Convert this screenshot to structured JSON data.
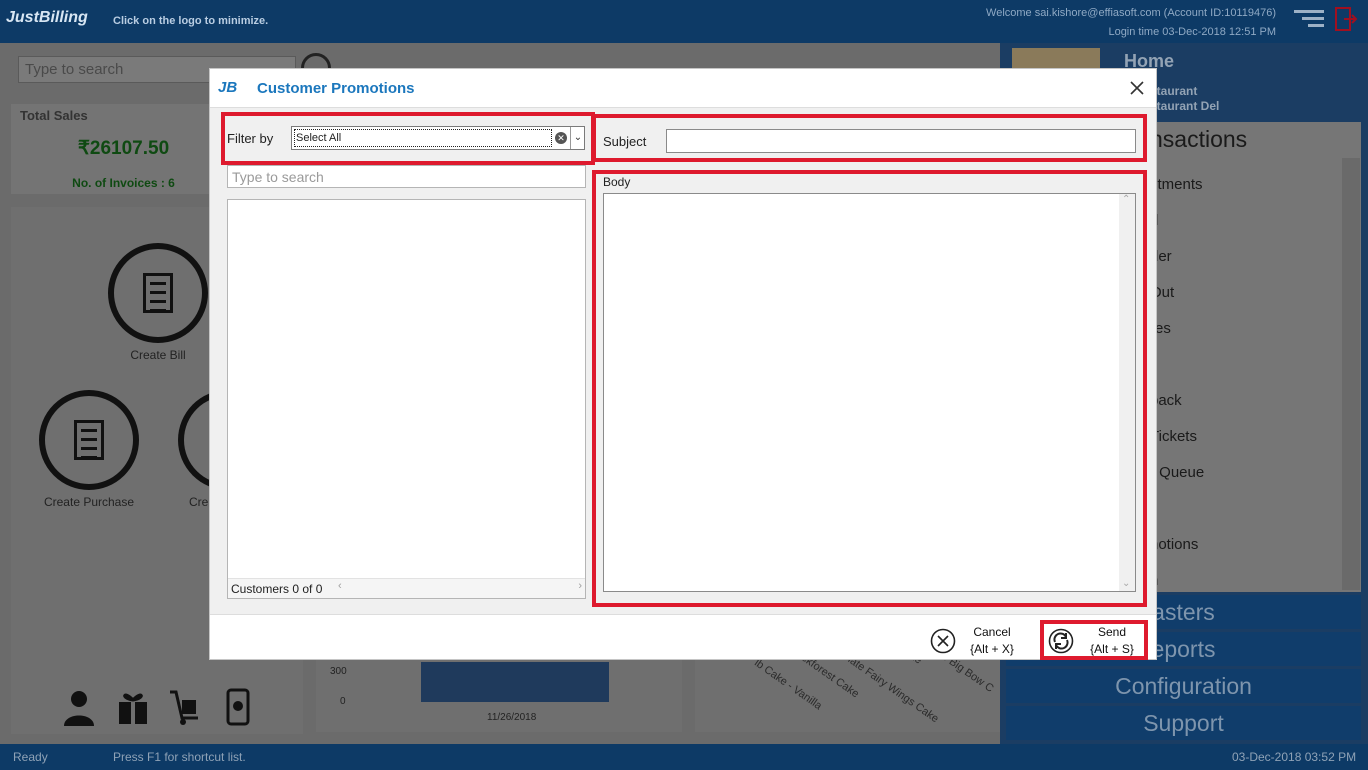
{
  "header": {
    "logo": "JustBilling",
    "logo_hint": "Click on the logo to minimize.",
    "welcome": "Welcome sai.kishore@effiasoft.com (Account ID:10119476)",
    "login_time": "Login time  03-Dec-2018 12:51 PM"
  },
  "background": {
    "search_placeholder": "Type to search",
    "total_sales_label": "Total Sales",
    "total_sales_value": "₹26107.50",
    "invoices": "No. of Invoices : 6",
    "create_bill": "Create Bill",
    "create_purchase": "Create Purchase",
    "create_partial": "Cre",
    "chart_tick_300": "300",
    "chart_tick_0": "0",
    "chart_date": "11/26/2018",
    "rotated_labels": [
      "lb Cake - Vanilla",
      "lackforest Cake",
      "colate Fairy Wings Cake",
      "colate Big Bow C",
      "te Cake"
    ]
  },
  "right_panel": {
    "home": "Home",
    "sub1": "staurant",
    "sub2": "staurant Del",
    "transactions": "nsactions",
    "items": [
      "stments",
      "d",
      "der",
      "Out",
      "res",
      "back",
      "Tickets",
      "r Queue",
      "notions",
      "n"
    ],
    "masters": "asters",
    "reports": "eports",
    "configuration": "Configuration",
    "support": "Support"
  },
  "status": {
    "ready": "Ready",
    "hint": "Press F1 for shortcut list.",
    "datetime": "03-Dec-2018 03:52 PM"
  },
  "modal": {
    "logo": "JB",
    "title": "Customer Promotions",
    "filter_label": "Filter by",
    "filter_value": "Select All",
    "search_placeholder": "Type to search",
    "customers_count": "Customers 0 of 0",
    "subject_label": "Subject",
    "subject_value": "",
    "body_label": "Body",
    "body_value": "",
    "cancel_label": "Cancel",
    "cancel_shortcut": "{Alt + X}",
    "send_label": "Send",
    "send_shortcut": "{Alt + S}"
  },
  "colors": {
    "accent": "#1b77bd",
    "highlight": "#de1a2e",
    "topbar": "#0d3a66"
  }
}
